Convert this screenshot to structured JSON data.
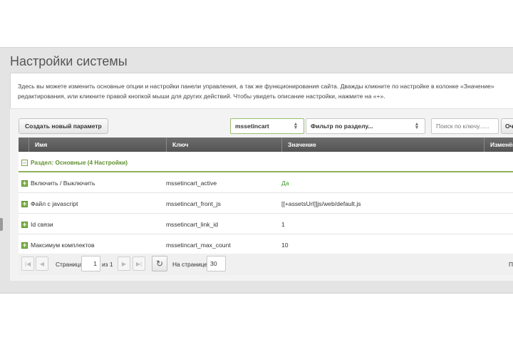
{
  "page": {
    "title": "Настройки системы",
    "intro_line1": "Здесь вы можете изменить основные опции и настройки панели управления, а так же функционирования сайта. Дважды кликните по настройке в колонке «Значение»",
    "intro_line2": "редактирования, или кликните правой кнопкой мыши для других действий. Чтобы увидеть описание настройки, нажмите на «+»."
  },
  "toolbar": {
    "create_label": "Создать новый параметр",
    "namespace_value": "mssetincart",
    "area_filter_placeholder": "Фильтр по разделу...",
    "search_placeholder": "Поиск по ключу......",
    "clear_label": "Оч"
  },
  "grid": {
    "columns": [
      "Имя",
      "Ключ",
      "Значение",
      "Изменён"
    ],
    "group_label": "Раздел: Основные (4 Настройки)",
    "rows": [
      {
        "name": "Включить / Выключить",
        "key": "mssetincart_active",
        "value": "Да"
      },
      {
        "name": "Файл с javascript",
        "key": "mssetincart_front_js",
        "value": "[[+assetsUrl]]js/web/default.js"
      },
      {
        "name": "Id связи",
        "key": "mssetincart_link_id",
        "value": "1"
      },
      {
        "name": "Максимум комплектов",
        "key": "mssetincart_max_count",
        "value": "10"
      }
    ]
  },
  "pager": {
    "page_label": "Страница",
    "page_value": "1",
    "of_label": "из 1",
    "per_page_label": "На странице:",
    "per_page_value": "30",
    "right_cut": "П"
  },
  "colors": {
    "accent_green": "#5f8f2e",
    "header_gray": "#5e5e5e"
  }
}
